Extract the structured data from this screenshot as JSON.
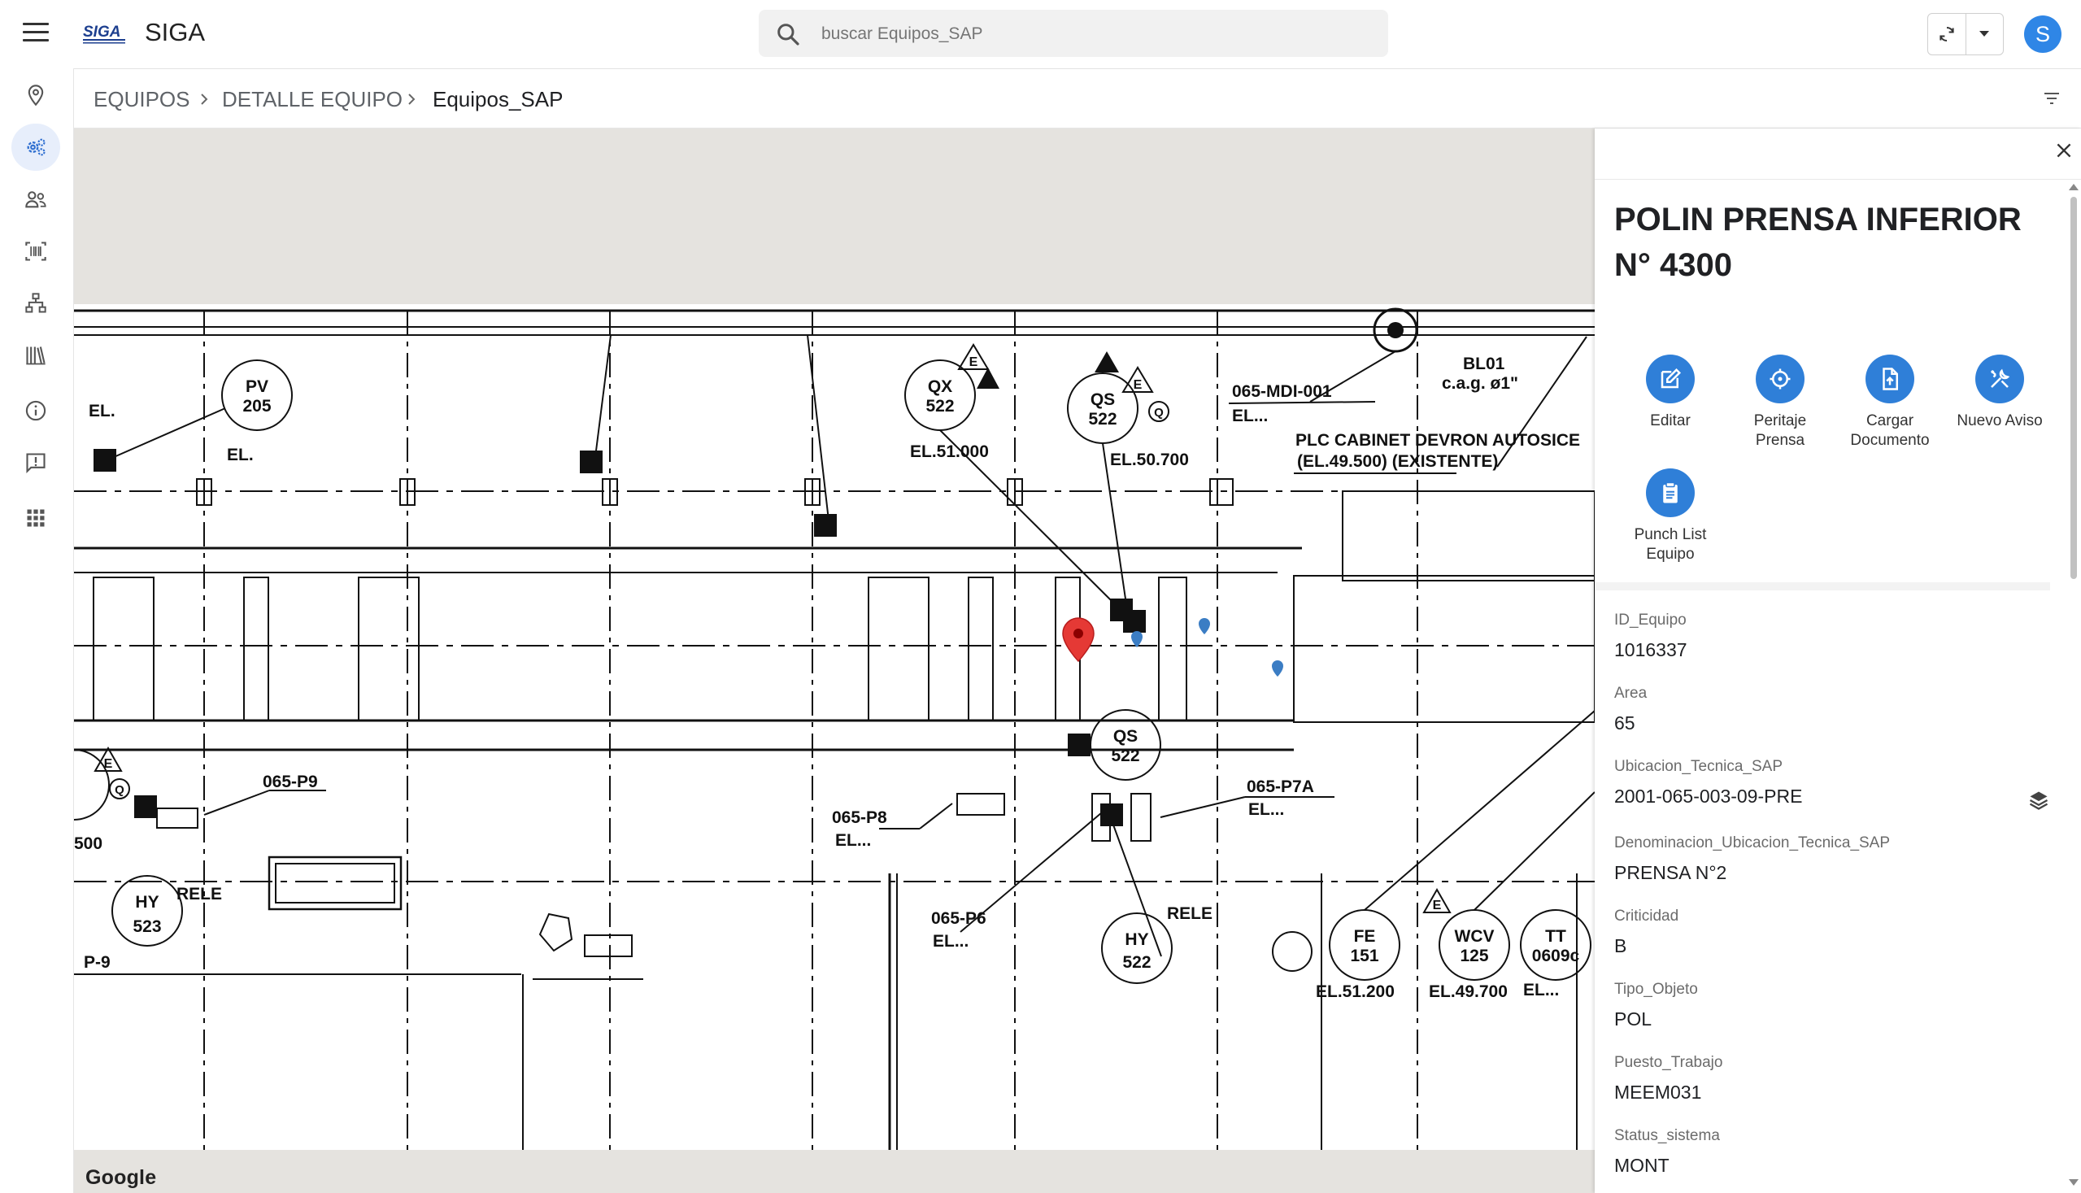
{
  "app": {
    "title": "SIGA",
    "logo_text": "SIGA"
  },
  "search": {
    "placeholder": "buscar Equipos_SAP"
  },
  "user": {
    "initial": "S"
  },
  "breadcrumb": [
    "EQUIPOS",
    "DETALLE EQUIPO",
    "Equipos_SAP"
  ],
  "sidebar": {
    "items": [
      {
        "icon": "location-pin-icon",
        "active": false
      },
      {
        "icon": "equipment-gears-icon",
        "active": true
      },
      {
        "icon": "users-icon",
        "active": false
      },
      {
        "icon": "barcode-scan-icon",
        "active": false
      },
      {
        "icon": "hierarchy-icon",
        "active": false
      },
      {
        "icon": "library-icon",
        "active": false
      },
      {
        "icon": "info-icon",
        "active": false
      },
      {
        "icon": "feedback-icon",
        "active": false
      },
      {
        "icon": "apps-grid-icon",
        "active": false
      }
    ]
  },
  "map": {
    "attribution": "Google",
    "labels": {
      "pv205_a": "PV",
      "pv205_b": "205",
      "qx522_a": "QX",
      "qx522_b": "522",
      "qs522_a": "QS",
      "qs522_b": "522",
      "qs522b_a": "QS",
      "qs522b_b": "522",
      "hy523_a": "HY",
      "hy523_b": "523",
      "hy522_a": "HY",
      "hy522_b": "522",
      "fe151_a": "FE",
      "fe151_b": "151",
      "wcv125_a": "WCV",
      "wcv125_b": "125",
      "tt_a": "TT",
      "tt_b": "0609c",
      "el1": "EL.",
      "el2": "EL.",
      "el51000": "EL.51.000",
      "el50700": "EL.50.700",
      "mdi": "065-MDI-001",
      "mdi_el": "EL...",
      "bl01": "BL01",
      "cag": "c.a.g. ø1\"",
      "plc1": "PLC CABINET DEVRON AUTOSICE",
      "plc2": "(EL.49.500)    (EXISTENTE)",
      "p9": "065-P9",
      "p8": "065-P8",
      "p8_el": "EL...",
      "p7a": "065-P7A",
      "p7a_el": "EL...",
      "p6": "065-P6",
      "p6_el": "EL...",
      "rele1": "RELE",
      "rele2": "RELE",
      "v500": "500",
      "p9b": "P-9",
      "el51200": "EL.51.200",
      "el49700": "EL.49.700",
      "el_tt": "EL...",
      "e": "E",
      "q": "Q"
    }
  },
  "panel": {
    "title": "POLIN PRENSA INFERIOR N° 4300",
    "actions": [
      {
        "label": "Editar",
        "icon": "edit-icon"
      },
      {
        "label": "Peritaje Prensa",
        "icon": "crosshair-icon"
      },
      {
        "label": "Cargar Documento",
        "icon": "upload-document-icon"
      },
      {
        "label": "Nuevo Aviso",
        "icon": "tools-icon"
      },
      {
        "label": "Punch List Equipo",
        "icon": "clipboard-icon"
      }
    ],
    "fields": [
      {
        "key": "ID_Equipo",
        "value": "1016337"
      },
      {
        "key": "Area",
        "value": "65"
      },
      {
        "key": "Ubicacion_Tecnica_SAP",
        "value": "2001-065-003-09-PRE"
      },
      {
        "key": "Denominacion_Ubicacion_Tecnica_SAP",
        "value": "PRENSA N°2"
      },
      {
        "key": "Criticidad",
        "value": "B"
      },
      {
        "key": "Tipo_Objeto",
        "value": "POL"
      },
      {
        "key": "Puesto_Trabajo",
        "value": "MEEM031"
      },
      {
        "key": "Status_sistema",
        "value": "MONT"
      }
    ]
  },
  "colors": {
    "accent": "#2f7fd8",
    "avatar": "#2f86e6",
    "marker": "#e53935",
    "active_nav": "#e7eefb"
  }
}
